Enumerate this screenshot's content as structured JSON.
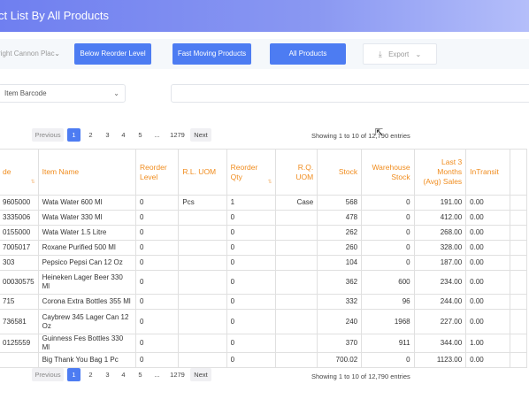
{
  "header": {
    "title": "ct List By All Products"
  },
  "toolbar": {
    "branch_value": "right Cannon Plac",
    "below_reorder_label": "Below Reorder Level",
    "fast_moving_label": "Fast Moving Products",
    "all_products_label": "All Products",
    "export_label": "Export"
  },
  "filter": {
    "field_value": "Item Barcode",
    "search_value": ""
  },
  "pagination": {
    "previous": "Previous",
    "pages": [
      "1",
      "2",
      "3",
      "4",
      "5"
    ],
    "ellipsis": "...",
    "last_page": "1279",
    "next": "Next",
    "showing": "Showing 1 to 10 of 12,790 entries"
  },
  "table": {
    "headers": {
      "code": "de",
      "item_name": "Item Name",
      "reorder_level": "Reorder Level",
      "rl_uom": "R.L. UOM",
      "reorder_qty": "Reorder Qty",
      "rq_uom": "R.Q. UOM",
      "stock": "Stock",
      "warehouse_stock": "Warehouse Stock",
      "avg_sales": "Last 3 Months (Avg) Sales",
      "in_transit": "InTransit"
    },
    "rows": [
      {
        "code": "9605000",
        "name": "Wata Water 600 Ml",
        "reorder_level": "0",
        "rl_uom": "Pcs",
        "reorder_qty": "1",
        "rq_uom": "Case",
        "stock": "568",
        "warehouse": "0",
        "avg_sales": "191.00",
        "in_transit": "0.00"
      },
      {
        "code": "3335006",
        "name": "Wata Water 330 Ml",
        "reorder_level": "0",
        "rl_uom": "",
        "reorder_qty": "0",
        "rq_uom": "",
        "stock": "478",
        "warehouse": "0",
        "avg_sales": "412.00",
        "in_transit": "0.00"
      },
      {
        "code": "0155000",
        "name": "Wata Water 1.5 Litre",
        "reorder_level": "0",
        "rl_uom": "",
        "reorder_qty": "0",
        "rq_uom": "",
        "stock": "262",
        "warehouse": "0",
        "avg_sales": "268.00",
        "in_transit": "0.00"
      },
      {
        "code": "7005017",
        "name": "Roxane Purified 500 Ml",
        "reorder_level": "0",
        "rl_uom": "",
        "reorder_qty": "0",
        "rq_uom": "",
        "stock": "260",
        "warehouse": "0",
        "avg_sales": "328.00",
        "in_transit": "0.00"
      },
      {
        "code": "303",
        "name": "Pepsico Pepsi Can 12 Oz",
        "reorder_level": "0",
        "rl_uom": "",
        "reorder_qty": "0",
        "rq_uom": "",
        "stock": "104",
        "warehouse": "0",
        "avg_sales": "187.00",
        "in_transit": "0.00"
      },
      {
        "code": "00030575",
        "name": "Heineken Lager Beer 330 Ml",
        "reorder_level": "0",
        "rl_uom": "",
        "reorder_qty": "0",
        "rq_uom": "",
        "stock": "362",
        "warehouse": "600",
        "avg_sales": "234.00",
        "in_transit": "0.00"
      },
      {
        "code": "715",
        "name": "Corona Extra Bottles 355 Ml",
        "reorder_level": "0",
        "rl_uom": "",
        "reorder_qty": "0",
        "rq_uom": "",
        "stock": "332",
        "warehouse": "96",
        "avg_sales": "244.00",
        "in_transit": "0.00"
      },
      {
        "code": "736581",
        "name": "Caybrew 345 Lager Can 12 Oz",
        "reorder_level": "0",
        "rl_uom": "",
        "reorder_qty": "0",
        "rq_uom": "",
        "stock": "240",
        "warehouse": "1968",
        "avg_sales": "227.00",
        "in_transit": "0.00"
      },
      {
        "code": "0125559",
        "name": "Guinness Fes Bottles 330 Ml",
        "reorder_level": "0",
        "rl_uom": "",
        "reorder_qty": "0",
        "rq_uom": "",
        "stock": "370",
        "warehouse": "911",
        "avg_sales": "344.00",
        "in_transit": "1.00"
      },
      {
        "code": "",
        "name": "Big Thank You Bag 1 Pc",
        "reorder_level": "0",
        "rl_uom": "",
        "reorder_qty": "0",
        "rq_uom": "",
        "stock": "700.02",
        "warehouse": "0",
        "avg_sales": "1123.00",
        "in_transit": "0.00"
      }
    ]
  },
  "colors": {
    "header_start": "#6f7ff0",
    "button_blue": "#4d7cf2",
    "header_text_orange": "#f08c1e"
  }
}
